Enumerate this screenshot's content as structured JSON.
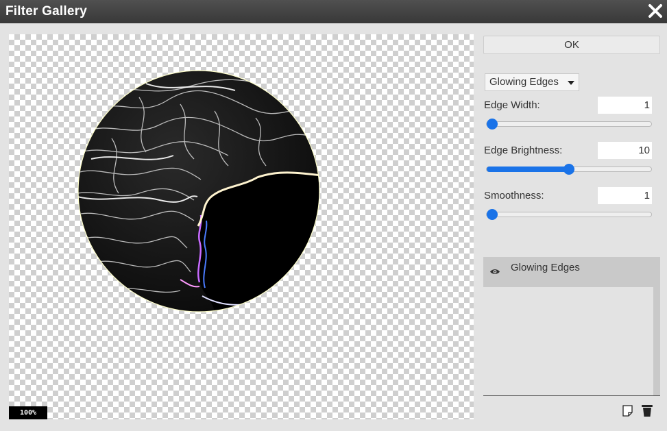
{
  "window": {
    "title": "Filter Gallery"
  },
  "canvas": {
    "zoom": "100%"
  },
  "actions": {
    "ok_label": "OK"
  },
  "filter": {
    "selected": "Glowing Edges"
  },
  "params": {
    "edge_width": {
      "label": "Edge Width:",
      "value": "1",
      "level_fraction": 0.0
    },
    "edge_brightness": {
      "label": "Edge Brightness:",
      "value": "10",
      "level_fraction": 0.5
    },
    "smoothness": {
      "label": "Smoothness:",
      "value": "1",
      "level_fraction": 0.0
    }
  },
  "layers": [
    {
      "name": "Glowing Edges",
      "visible": true,
      "icon": "eye-icon"
    }
  ],
  "footer_icons": [
    "new-layer-icon",
    "trash-icon"
  ],
  "colors": {
    "accent": "#1a73e8",
    "titlebar": "#404040",
    "panel": "#e3e3e3"
  }
}
